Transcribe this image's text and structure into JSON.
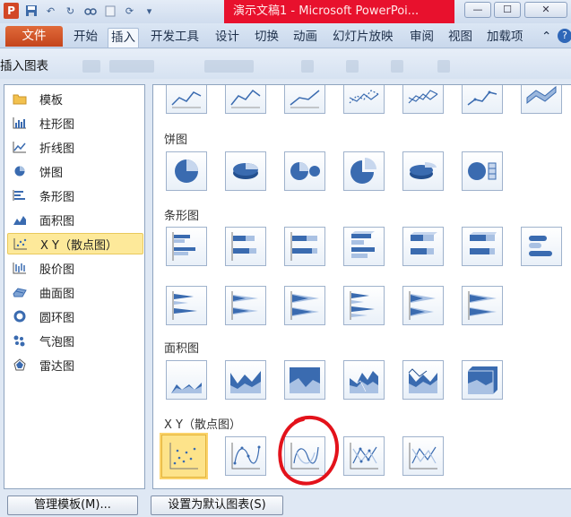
{
  "window": {
    "title": "演示文稿1 - Microsoft PowerPoi...",
    "app_badge": "P",
    "buttons": {
      "minimize": "—",
      "maximize": "☐",
      "close": "✕"
    }
  },
  "ribbon": {
    "tabs": [
      "文件",
      "开始",
      "插入",
      "开发工具",
      "设计",
      "切换",
      "动画",
      "幻灯片放映",
      "审阅",
      "视图",
      "加载项"
    ],
    "active_tab": "插入",
    "collapse": "⌃",
    "help": "?"
  },
  "dialog": {
    "title": "插入图表",
    "categories": [
      {
        "label": "模板",
        "icon": "folder-icon"
      },
      {
        "label": "柱形图",
        "icon": "column-chart-icon"
      },
      {
        "label": "折线图",
        "icon": "line-chart-icon"
      },
      {
        "label": "饼图",
        "icon": "pie-chart-icon"
      },
      {
        "label": "条形图",
        "icon": "bar-chart-icon"
      },
      {
        "label": "面积图",
        "icon": "area-chart-icon"
      },
      {
        "label": "X Y（散点图）",
        "icon": "scatter-chart-icon"
      },
      {
        "label": "股价图",
        "icon": "stock-chart-icon"
      },
      {
        "label": "曲面图",
        "icon": "surface-chart-icon"
      },
      {
        "label": "圆环图",
        "icon": "doughnut-chart-icon"
      },
      {
        "label": "气泡图",
        "icon": "bubble-chart-icon"
      },
      {
        "label": "雷达图",
        "icon": "radar-chart-icon"
      }
    ],
    "selected_category": "X Y（散点图）",
    "sections": {
      "pie": "饼图",
      "bar": "条形图",
      "area": "面积图",
      "scatter": "X Y（散点图）"
    },
    "buttons": {
      "manage_templates": "管理模板(M)...",
      "set_default": "设置为默认图表(S)"
    }
  },
  "colors": {
    "accent_selection": "#fde99a",
    "chart_blue": "#3a6bb0",
    "annotation_red": "#e3121b"
  }
}
